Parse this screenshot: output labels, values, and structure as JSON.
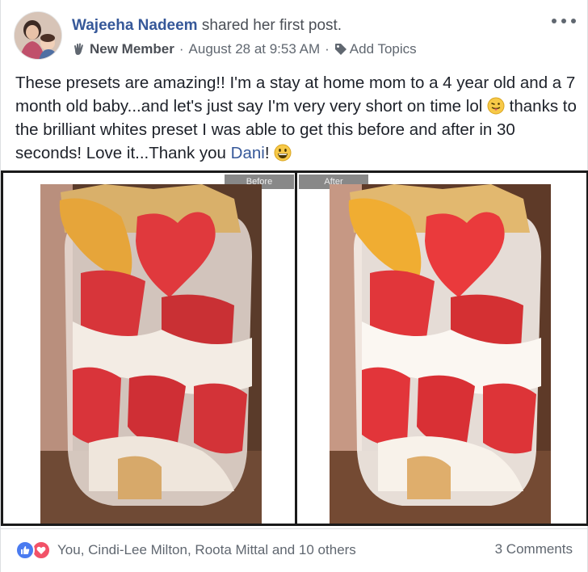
{
  "post": {
    "author_name": "Wajeeha Nadeem",
    "author_action": " shared her first post.",
    "badge": "New Member",
    "timestamp": "August 28 at 9:53 AM",
    "add_topics": "Add Topics",
    "text_part1": "These presets are amazing!! I'm a stay at home mom to a 4 year old and a 7 month old baby...and let's just say I'm very very short on time lol ",
    "text_part2": " thanks to the brilliant whites preset I was able to get this before and after in 30 seconds! Love it...Thank you ",
    "mention": "Dani",
    "text_part3": "! "
  },
  "photo": {
    "before_label": "Before",
    "after_label": "After"
  },
  "footer": {
    "reactions_text": "You, Cindi-Lee Milton, Roota Mittal and 10 others",
    "comments_count": "3 Comments"
  },
  "icons": {
    "more": "more-horizontal-icon",
    "badge": "waving-hand-icon",
    "topics": "tag-icon",
    "emoji1": "tongue-out-emoji",
    "emoji2": "grinning-emoji",
    "like": "like-icon",
    "love": "love-icon"
  },
  "colors": {
    "link": "#365899",
    "like": "#4a7bf0",
    "love": "#f25268",
    "meta": "#606770"
  }
}
